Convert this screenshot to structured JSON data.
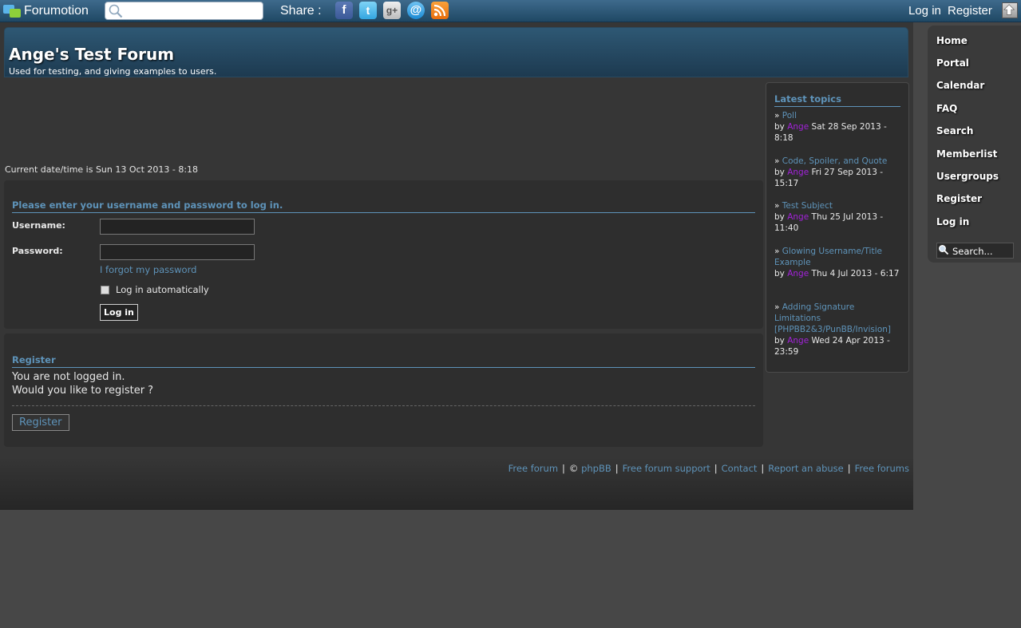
{
  "toolbar": {
    "brand": "Forumotion",
    "share_label": "Share :",
    "share_icons": [
      "facebook-icon",
      "twitter-icon",
      "google-plus-icon",
      "email-icon",
      "rss-icon"
    ],
    "login": "Log in",
    "register": "Register"
  },
  "header": {
    "title": "Ange's Test Forum",
    "description": "Used for testing, and giving examples to users."
  },
  "datetime": "Current date/time is Sun 13 Oct 2013 - 8:18",
  "login_form": {
    "title": "Please enter your username and password to log in.",
    "username_label": "Username:",
    "password_label": "Password:",
    "forgot_link": "I forgot my password",
    "auto_login_label": "Log in automatically",
    "submit": "Log in"
  },
  "register_panel": {
    "title": "Register",
    "line1": "You are not logged in.",
    "line2": "Would you like to register ?",
    "button": "Register"
  },
  "latest_topics": {
    "title": "Latest topics",
    "items": [
      {
        "prefix": "» ",
        "subject": "Poll",
        "by": "by ",
        "user": "Ange",
        "date": " Sat 28 Sep 2013 - 8:18"
      },
      {
        "prefix": "» ",
        "subject": "Code, Spoiler, and Quote",
        "by": "by ",
        "user": "Ange",
        "date": " Fri 27 Sep 2013 - 15:17"
      },
      {
        "prefix": "» ",
        "subject": "Test Subject",
        "by": "by ",
        "user": "Ange",
        "date": " Thu 25 Jul 2013 - 11:40"
      },
      {
        "prefix": "» ",
        "subject": "Glowing Username/Title Example",
        "by": "by ",
        "user": "Ange",
        "date": " Thu 4 Jul 2013 - 6:17"
      },
      {
        "prefix": "» ",
        "subject": "Adding Signature Limitations [PHPBB2&3/PunBB/Invision]",
        "by": "by ",
        "user": "Ange",
        "date": " Wed 24 Apr 2013 - 23:59"
      }
    ]
  },
  "footer": {
    "links": [
      "Free forum",
      "phpBB",
      "Free forum support",
      "Contact",
      "Report an abuse",
      "Free forums"
    ],
    "copyright": "©",
    "separator": "|"
  },
  "sidenav": {
    "items": [
      "Home",
      "Portal",
      "Calendar",
      "FAQ",
      "Search",
      "Memberlist",
      "Usergroups",
      "Register",
      "Log in"
    ],
    "search_placeholder": "Search..."
  },
  "colors": {
    "link": "#5e93b9",
    "username": "#a222d9",
    "toolbar": "#2d5a7b"
  }
}
